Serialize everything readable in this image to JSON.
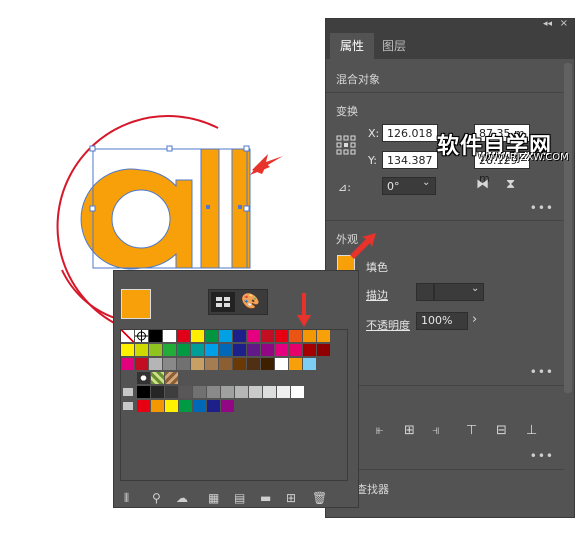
{
  "artwork": {
    "text": "all",
    "fill_color": "#F7A00A",
    "stroke_color": "#4f79c9"
  },
  "properties_panel": {
    "tabs": [
      "属性",
      "图层"
    ],
    "active_tab": "属性",
    "selection_label": "混合对象",
    "transform": {
      "title": "变换",
      "x_label": "X:",
      "x_value": "126.018",
      "y_label": "Y:",
      "y_value": "134.387",
      "w_value": "87.35 m",
      "h_value": "28.129 m",
      "angle_label": "⊿:",
      "angle_value": "0°"
    },
    "appearance": {
      "title": "外观",
      "fill_label": "填色",
      "fill_color": "#F7A00A",
      "stroke_label": "描边",
      "opacity_label": "不透明度",
      "opacity_value": "100%"
    },
    "pathfinder_label": "查找器",
    "more": "•••"
  },
  "watermark": {
    "title": "软件自学网",
    "url": "WWW.RJZXW.COM"
  },
  "swatches_panel": {
    "current_fill": "#F7A00A",
    "rows": [
      [
        "none",
        "register",
        "#000000",
        "#ffffff",
        "#e1001a",
        "#ffed00",
        "#009640",
        "#00a0e3",
        "#1d2088",
        "#e4007f",
        "#c30d23",
        "#e60012",
        "#ea5514",
        "#f39800",
        "#f7a00a"
      ],
      [
        "#fff100",
        "#cfdb00",
        "#8fc31f",
        "#22ac38",
        "#009944",
        "#009e96",
        "#00a0e9",
        "#0068b7",
        "#1d2088",
        "#601986",
        "#920783",
        "#e4007f",
        "#e5006a",
        "#a40000",
        "#8f0000"
      ],
      [
        "#e4007f",
        "#c30d23",
        "#b5b5b6",
        "#898989",
        "#727171",
        "#c9a063",
        "#a67c52",
        "#8b5e34",
        "#6a3906",
        "#503014",
        "#3e2000",
        "#ffffff",
        "#f7a00a",
        "#7ecef4"
      ],
      [
        "pattern1",
        "pattern2",
        "pattern3"
      ],
      [
        "#000000",
        "#262626",
        "#3e3e3e",
        "#595757",
        "#727171",
        "#898989",
        "#9fa0a0",
        "#b5b5b6",
        "#c9caca",
        "#dcdddd",
        "#efefef",
        "#ffffff"
      ],
      [
        "#e60012",
        "#f39800",
        "#fff100",
        "#009944",
        "#0068b7",
        "#1d2088",
        "#920783"
      ]
    ]
  }
}
